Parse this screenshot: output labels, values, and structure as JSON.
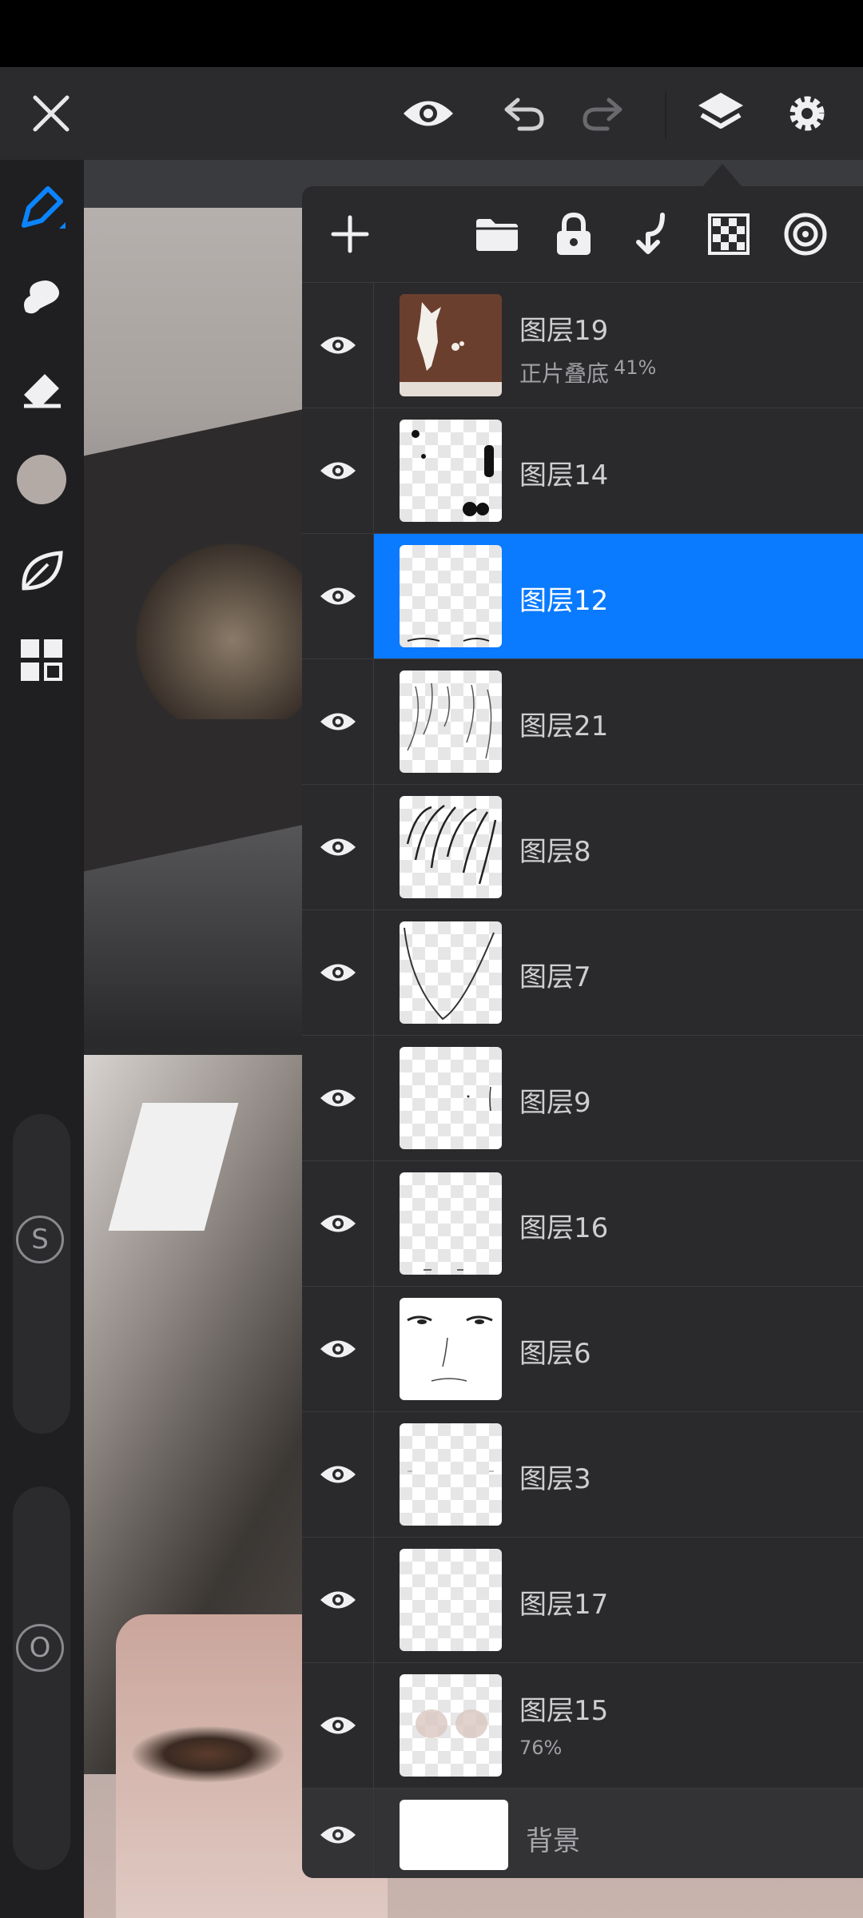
{
  "app": {
    "accent_color": "#0a7aff"
  },
  "topbar": {
    "close_icon": "close-icon",
    "visibility_icon": "eye-icon",
    "undo_icon": "undo-icon",
    "redo_icon": "redo-icon",
    "layers_icon": "layers-icon",
    "settings_icon": "gear-icon"
  },
  "sidebar": {
    "tools": [
      "brush-icon",
      "smudge-icon",
      "eraser-icon",
      "color-swatch",
      "leaf-icon",
      "grid-icon"
    ],
    "size_slider_label": "S",
    "opacity_slider_label": "O"
  },
  "layer_panel": {
    "toolbar_icons": [
      "plus-icon",
      "folder-icon",
      "lock-icon",
      "merge-down-icon",
      "transparency-icon",
      "target-icon"
    ],
    "layers": [
      {
        "name": "图层19",
        "blend": "正片叠底",
        "opacity": "41%",
        "selected": false
      },
      {
        "name": "图层14",
        "selected": false
      },
      {
        "name": "图层12",
        "selected": true
      },
      {
        "name": "图层21",
        "selected": false
      },
      {
        "name": "图层8",
        "selected": false
      },
      {
        "name": "图层7",
        "selected": false
      },
      {
        "name": "图层9",
        "selected": false
      },
      {
        "name": "图层16",
        "selected": false
      },
      {
        "name": "图层6",
        "selected": false
      },
      {
        "name": "图层3",
        "selected": false
      },
      {
        "name": "图层17",
        "selected": false
      },
      {
        "name": "图层15",
        "opacity": "76%",
        "selected": false
      }
    ],
    "background": {
      "name": "背景"
    }
  }
}
